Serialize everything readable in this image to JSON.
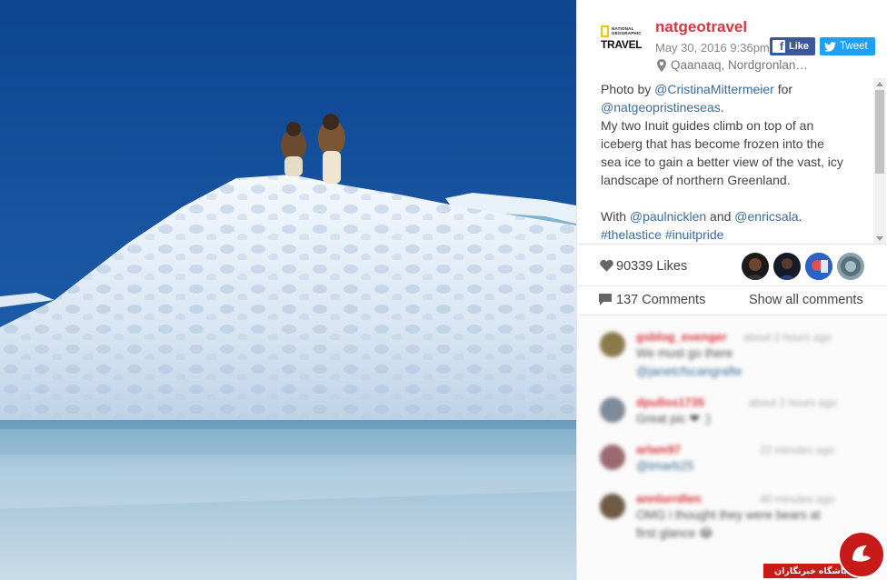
{
  "post": {
    "username": "natgeotravel",
    "date": "May 30, 2016 9:36pm",
    "location": "Qaanaaq, Nordgronlan…",
    "logo": {
      "small": "NATIONAL\nGEOGRAPHIC",
      "big": "TRAVEL"
    },
    "share": {
      "facebook_label": "Like",
      "twitter_label": "Tweet"
    },
    "caption": {
      "prefix": "Photo by ",
      "photographer": "@CristinaMittermeier",
      "for_word": " for",
      "org": "@natgeopristineseas",
      "period": ".",
      "body": "My two Inuit guides climb on top of an iceberg that has become frozen into the sea ice to gain a better view of the vast, icy landscape of northern Greenland.",
      "with_word": "With ",
      "mention1": "@paulnicklen",
      "and_word": " and ",
      "mention2": "@enricsala",
      "period2": ".",
      "tags": "#thelastice #inuitpride"
    },
    "likes": "90339 Likes",
    "comments_count": "137 Comments",
    "show_all": "Show all comments"
  },
  "comments": [
    {
      "name": "gsblog_evenger",
      "time": "about 2 hours ago",
      "text": "We must go there",
      "text2": "@janetcfscangrafte"
    },
    {
      "name": "dpullos1735",
      "time": "about 2 hours ago",
      "text": "Great pic ❤ :)",
      "text2": ""
    },
    {
      "name": "arlam97",
      "time": "22 minutes ago",
      "text": "@tmarb25",
      "text2": ""
    },
    {
      "name": "annlorrdlen",
      "time": "40 minutes ago",
      "text": "OMG i thought they were bears at",
      "text2": "first glance 😂"
    }
  ],
  "watermark": {
    "text": "باشگاه خبرنگاران"
  },
  "colors": {
    "username": "#d9363e",
    "link": "#3d6c99",
    "facebook": "#3b5998",
    "twitter": "#1da1f2",
    "sky": "#1c5aa6"
  },
  "icons": [
    "location-pin-icon",
    "facebook-icon",
    "twitter-icon",
    "heart-icon",
    "comment-icon"
  ]
}
